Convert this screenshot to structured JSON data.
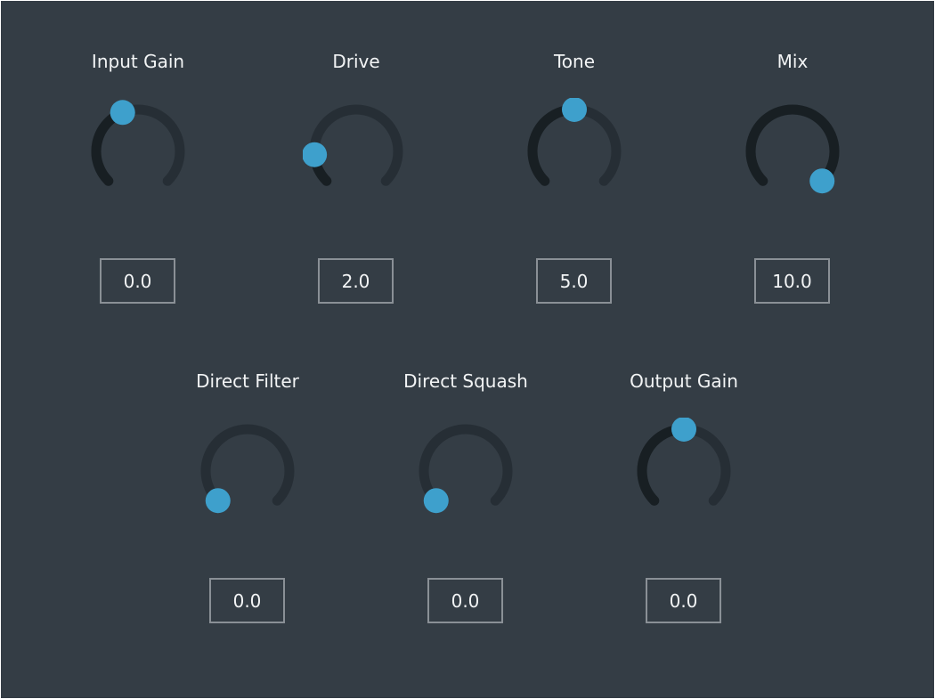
{
  "colors": {
    "background": "#343d45",
    "track": "#262e35",
    "fill": "#181f23",
    "handle": "#3ea0cc",
    "text": "#f2f4f5",
    "box_border": "#8a9096"
  },
  "controls": [
    {
      "id": "input-gain",
      "label": "Input Gain",
      "value": "0.0",
      "fraction": 0.42
    },
    {
      "id": "drive",
      "label": "Drive",
      "value": "2.0",
      "fraction": 0.15
    },
    {
      "id": "tone",
      "label": "Tone",
      "value": "5.0",
      "fraction": 0.5
    },
    {
      "id": "mix",
      "label": "Mix",
      "value": "10.0",
      "fraction": 1.0
    },
    {
      "id": "direct-filter",
      "label": "Direct Filter",
      "value": "0.0",
      "fraction": 0.0
    },
    {
      "id": "direct-squash",
      "label": "Direct Squash",
      "value": "0.0",
      "fraction": 0.0
    },
    {
      "id": "output-gain",
      "label": "Output Gain",
      "value": "0.0",
      "fraction": 0.5
    }
  ]
}
